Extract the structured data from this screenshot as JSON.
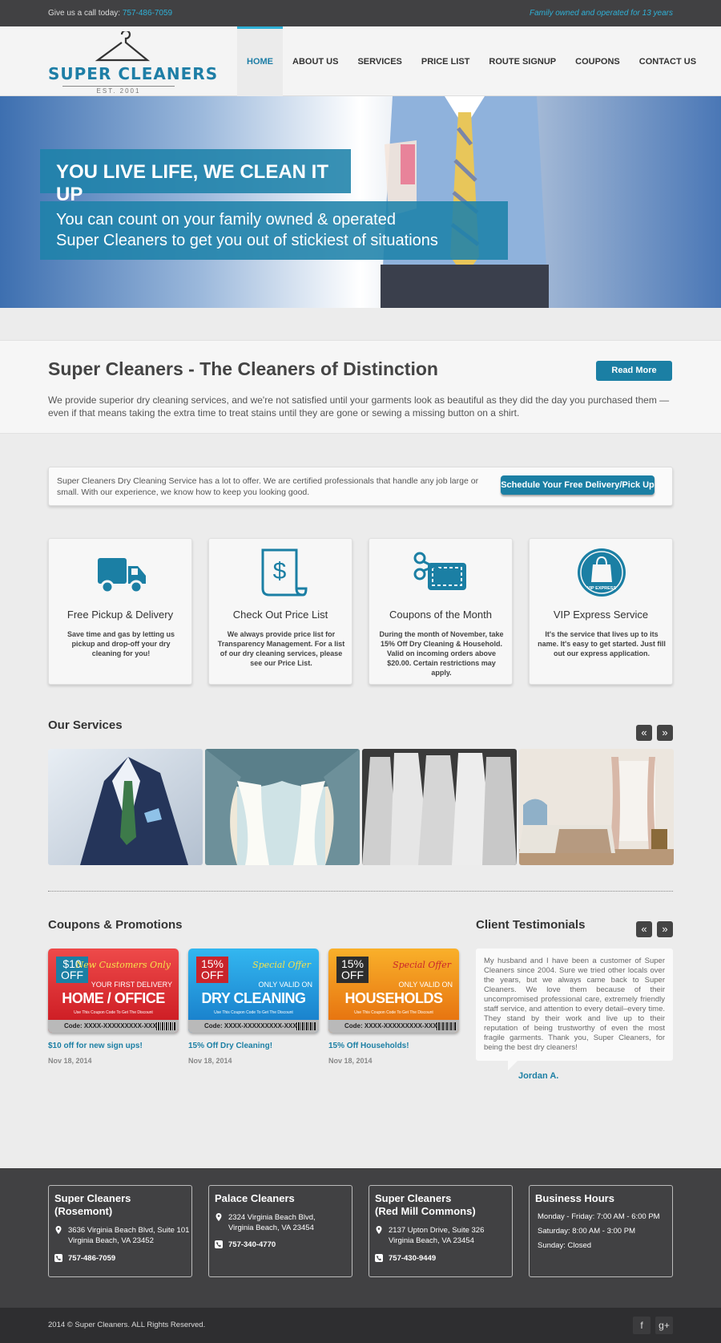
{
  "topbar": {
    "call_label": "Give us a call today:",
    "phone": "757-486-7059",
    "tagline": "Family owned and operated for 13 years"
  },
  "logo": {
    "name": "SUPER CLEANERS",
    "est": "EST. 2001"
  },
  "nav": [
    "HOME",
    "ABOUT US",
    "SERVICES",
    "PRICE LIST",
    "ROUTE SIGNUP",
    "COUPONS",
    "CONTACT US"
  ],
  "hero": {
    "headline": "YOU LIVE LIFE, WE CLEAN IT UP",
    "sub_line1": "You can count on your family owned & operated",
    "sub_line2": "Super Cleaners to get you out of stickiest of situations"
  },
  "distinction": {
    "title": "Super Cleaners - The Cleaners of Distinction",
    "button": "Read More",
    "text": "We provide superior dry cleaning services, and we're not satisfied until your garments look as beautiful as they did the day you purchased them — even if that means taking the extra time to treat stains until they are gone or sewing a missing button on a shirt."
  },
  "offer": {
    "text": "Super Cleaners Dry Cleaning Service has a lot to offer. We are certified professionals that handle any job large or small. With our experience, we know how to keep you looking good.",
    "button": "Schedule Your Free Delivery/Pick Up"
  },
  "features": [
    {
      "icon": "truck-icon",
      "title": "Free Pickup & Delivery",
      "text": "Save time and gas by letting us pickup and drop-off your dry cleaning for you!"
    },
    {
      "icon": "price-scroll-icon",
      "title": "Check Out Price List",
      "text": "We always provide price list for Transparency Management. For a list of our dry cleaning services, please see our Price List."
    },
    {
      "icon": "coupon-scissors-icon",
      "title": "Coupons of the Month",
      "text": "During the month of November, take 15% Off Dry Cleaning & Household. Valid on incoming orders above $20.00. Certain restrictions may apply."
    },
    {
      "icon": "vip-bag-icon",
      "title": "VIP Express Service",
      "icon_text": "VIP EXPRESS",
      "text": "It's the service that lives up to its name. It's easy to get started. Just fill out our express application."
    }
  ],
  "services": {
    "title": "Our Services",
    "prev": "«",
    "next": "»"
  },
  "coupons": {
    "title": "Coupons & Promotions",
    "items": [
      {
        "tag": "$10 OFF",
        "special": "New Customers Only",
        "sub": "YOUR FIRST DELIVERY",
        "main": "HOME / OFFICE",
        "use": "Use This Coupon Code To Get The Discount",
        "code": "Code: XXXX-XXXXXXXXX-XXX",
        "caption": "$10 off for new sign ups!",
        "date": "Nov 18, 2014",
        "bg": "#d9242c",
        "accent": "#1b7fa4",
        "special_color": "#f6e24c"
      },
      {
        "tag": "15% OFF",
        "special": "Special Offer",
        "sub": "ONLY VALID ON",
        "main": "DRY CLEANING",
        "use": "Use This Coupon Code To Get The Discount",
        "code": "Code: XXXX-XXXXXXXXX-XXX",
        "caption": "15% Off Dry Cleaning!",
        "date": "Nov 18, 2014",
        "bg": "#1a8ed8",
        "accent": "#c9242b",
        "special_color": "#f6e24c"
      },
      {
        "tag": "15% OFF",
        "special": "Special Offer",
        "sub": "ONLY VALID ON",
        "main": "HOUSEHOLDS",
        "use": "Use This Coupon Code To Get The Discount",
        "code": "Code: XXXX-XXXXXXXXX-XXX",
        "caption": "15% Off Households!",
        "date": "Nov 18, 2014",
        "bg": "#f08a10",
        "accent": "#2d2d2d",
        "special_color": "#c9242b"
      }
    ]
  },
  "testimonials": {
    "title": "Client Testimonials",
    "prev": "«",
    "next": "»",
    "text": "My husband and I have been a customer of Super Cleaners since 2004. Sure we tried other locals over the years, but we always came back to Super Cleaners. We love them because of their uncompromised professional care, extremely friendly staff service, and attention to every detail–every time. They stand by their work and live up to their reputation of being trustworthy of even the most fragile garments. Thank you, Super Cleaners, for being the best dry cleaners!",
    "author": "Jordan A."
  },
  "footer": {
    "locations": [
      {
        "name1": "Super Cleaners",
        "name2": "(Rosemont)",
        "addr1": "3636 Virginia Beach Blvd, Suite 101",
        "addr2": "Virginia Beach, VA 23452",
        "phone": "757-486-7059"
      },
      {
        "name1": "Palace Cleaners",
        "name2": "",
        "addr1": "2324 Virginia Beach Blvd,",
        "addr2": "Virginia Beach, VA 23454",
        "phone": "757-340-4770"
      },
      {
        "name1": "Super Cleaners",
        "name2": "(Red Mill Commons)",
        "addr1": "2137 Upton Drive, Suite 326",
        "addr2": "Virginia Beach, VA 23454",
        "phone": "757-430-9449"
      }
    ],
    "hours": {
      "title": "Business Hours",
      "lines": [
        "Monday - Friday: 7:00 AM - 6:00 PM",
        "Saturday: 8:00 AM - 3:00 PM",
        "Sunday: Closed"
      ]
    },
    "copyright": "2014 © Super Cleaners. ALL Rights Reserved.",
    "social": [
      "f",
      "g+"
    ]
  },
  "colors": {
    "brand": "#1b7fa4",
    "accent": "#2fb0d6",
    "dark": "#414143"
  }
}
